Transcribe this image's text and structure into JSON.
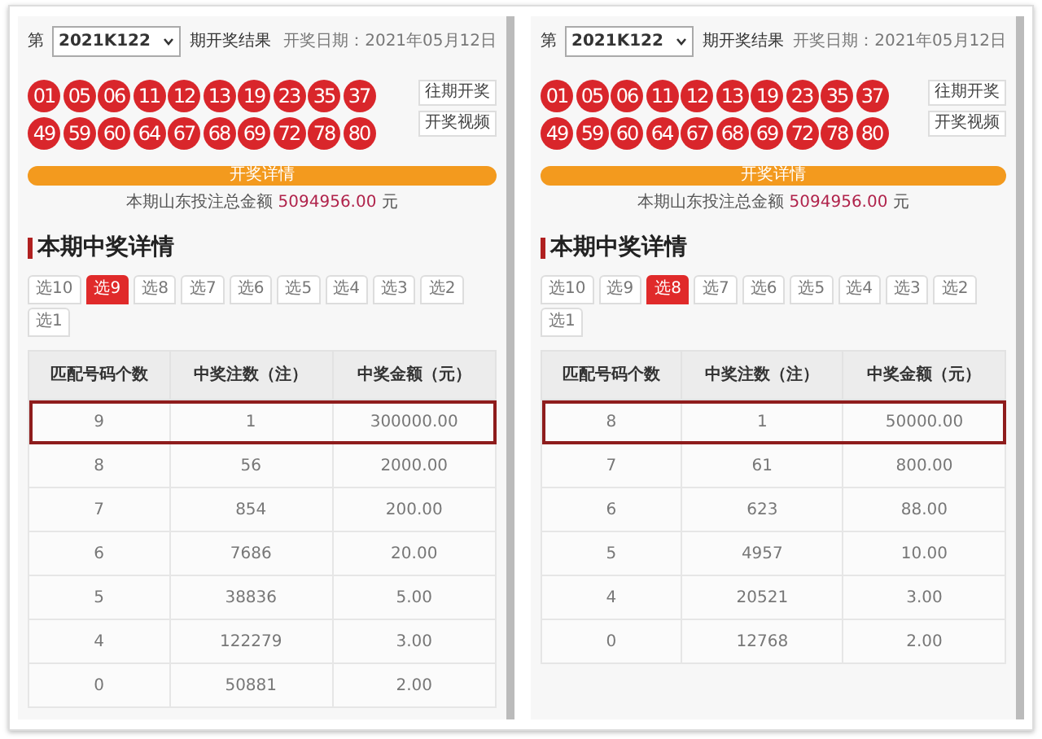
{
  "panels": [
    {
      "period_prefix": "第",
      "period": "2021K122",
      "period_suffix": "期开奖结果",
      "draw_date": "开奖日期：2021年05月12日",
      "balls": [
        "01",
        "05",
        "06",
        "11",
        "12",
        "13",
        "19",
        "23",
        "35",
        "37",
        "49",
        "59",
        "60",
        "64",
        "67",
        "68",
        "69",
        "72",
        "78",
        "80"
      ],
      "side_buttons": [
        "往期开奖",
        "开奖视频"
      ],
      "details_bar": "开奖详情",
      "total_label": "本期山东投注总金额",
      "total_amount": "5094956.00",
      "total_unit": "元",
      "section_title": "本期中奖详情",
      "tabs": [
        {
          "label": "选10",
          "selected": false
        },
        {
          "label": "选9",
          "selected": true
        },
        {
          "label": "选8",
          "selected": false
        },
        {
          "label": "选7",
          "selected": false
        },
        {
          "label": "选6",
          "selected": false
        },
        {
          "label": "选5",
          "selected": false
        },
        {
          "label": "选4",
          "selected": false
        },
        {
          "label": "选3",
          "selected": false
        },
        {
          "label": "选2",
          "selected": false
        },
        {
          "label": "选1",
          "selected": false
        }
      ],
      "table": {
        "columns": [
          "匹配号码个数",
          "中奖注数（注）",
          "中奖金额（元）"
        ],
        "rows": [
          {
            "cells": [
              "9",
              "1",
              "300000.00"
            ],
            "highlighted": true
          },
          {
            "cells": [
              "8",
              "56",
              "2000.00"
            ],
            "highlighted": false
          },
          {
            "cells": [
              "7",
              "854",
              "200.00"
            ],
            "highlighted": false
          },
          {
            "cells": [
              "6",
              "7686",
              "20.00"
            ],
            "highlighted": false
          },
          {
            "cells": [
              "5",
              "38836",
              "5.00"
            ],
            "highlighted": false
          },
          {
            "cells": [
              "4",
              "122279",
              "3.00"
            ],
            "highlighted": false
          },
          {
            "cells": [
              "0",
              "50881",
              "2.00"
            ],
            "highlighted": false
          }
        ]
      }
    },
    {
      "period_prefix": "第",
      "period": "2021K122",
      "period_suffix": "期开奖结果",
      "draw_date": "开奖日期：2021年05月12日",
      "balls": [
        "01",
        "05",
        "06",
        "11",
        "12",
        "13",
        "19",
        "23",
        "35",
        "37",
        "49",
        "59",
        "60",
        "64",
        "67",
        "68",
        "69",
        "72",
        "78",
        "80"
      ],
      "side_buttons": [
        "往期开奖",
        "开奖视频"
      ],
      "details_bar": "开奖详情",
      "total_label": "本期山东投注总金额",
      "total_amount": "5094956.00",
      "total_unit": "元",
      "section_title": "本期中奖详情",
      "tabs": [
        {
          "label": "选10",
          "selected": false
        },
        {
          "label": "选9",
          "selected": false
        },
        {
          "label": "选8",
          "selected": true
        },
        {
          "label": "选7",
          "selected": false
        },
        {
          "label": "选6",
          "selected": false
        },
        {
          "label": "选5",
          "selected": false
        },
        {
          "label": "选4",
          "selected": false
        },
        {
          "label": "选3",
          "selected": false
        },
        {
          "label": "选2",
          "selected": false
        },
        {
          "label": "选1",
          "selected": false
        }
      ],
      "table": {
        "columns": [
          "匹配号码个数",
          "中奖注数（注）",
          "中奖金额（元）"
        ],
        "rows": [
          {
            "cells": [
              "8",
              "1",
              "50000.00"
            ],
            "highlighted": true
          },
          {
            "cells": [
              "7",
              "61",
              "800.00"
            ],
            "highlighted": false
          },
          {
            "cells": [
              "6",
              "623",
              "88.00"
            ],
            "highlighted": false
          },
          {
            "cells": [
              "5",
              "4957",
              "10.00"
            ],
            "highlighted": false
          },
          {
            "cells": [
              "4",
              "20521",
              "3.00"
            ],
            "highlighted": false
          },
          {
            "cells": [
              "0",
              "12768",
              "2.00"
            ],
            "highlighted": false
          }
        ]
      }
    }
  ]
}
